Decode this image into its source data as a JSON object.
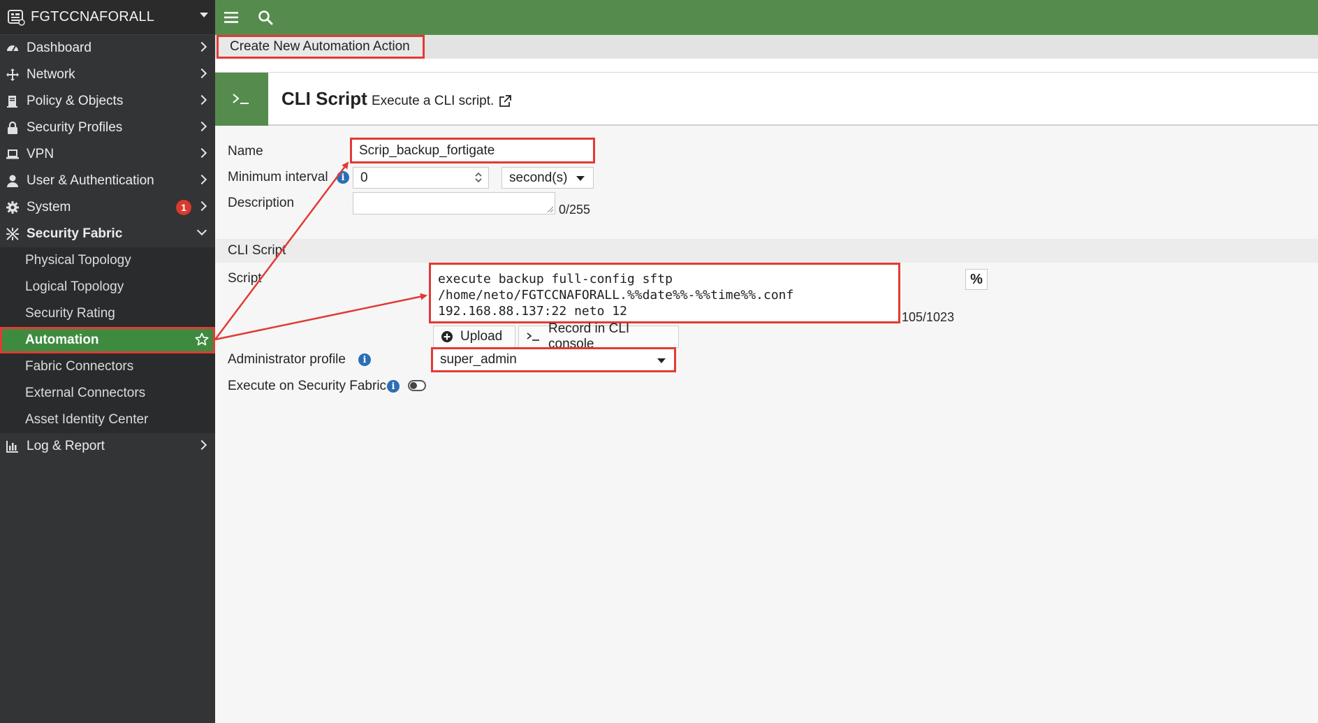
{
  "brand": {
    "name": "FGTCCNAFORALL"
  },
  "sidebar": {
    "items": [
      {
        "label": "Dashboard",
        "icon": "dashboard-icon"
      },
      {
        "label": "Network",
        "icon": "network-icon"
      },
      {
        "label": "Policy & Objects",
        "icon": "policy-icon"
      },
      {
        "label": "Security Profiles",
        "icon": "lock-icon"
      },
      {
        "label": "VPN",
        "icon": "laptop-icon"
      },
      {
        "label": "User & Authentication",
        "icon": "user-icon"
      },
      {
        "label": "System",
        "icon": "gear-icon",
        "badge": "1"
      },
      {
        "label": "Security Fabric",
        "icon": "fabric-icon"
      }
    ],
    "fabric_sub": [
      {
        "label": "Physical Topology"
      },
      {
        "label": "Logical Topology"
      },
      {
        "label": "Security Rating"
      },
      {
        "label": "Automation"
      },
      {
        "label": "Fabric Connectors"
      },
      {
        "label": "External Connectors"
      },
      {
        "label": "Asset Identity Center"
      }
    ],
    "log_report": {
      "label": "Log & Report",
      "icon": "chart-icon"
    }
  },
  "breadcrumb": {
    "title": "Create New Automation Action"
  },
  "action": {
    "title": "CLI Script",
    "description": "Execute a CLI script."
  },
  "form": {
    "name_label": "Name",
    "name_value": "Scrip_backup_fortigate",
    "interval_label": "Minimum interval",
    "interval_value": "0",
    "interval_unit": "second(s)",
    "description_label": "Description",
    "description_value": "",
    "description_count": "0/255",
    "section_title": "CLI Script",
    "script_label": "Script",
    "script_value": "execute backup full-config sftp\n/home/neto/FGTCCNAFORALL.%%date%%-%%time%%.conf\n192.168.88.137:22 neto 12",
    "script_count": "105/1023",
    "percent_symbol": "%",
    "upload_label": "Upload",
    "record_label": "Record in CLI console",
    "admin_profile_label": "Administrator profile",
    "admin_profile_value": "super_admin",
    "exec_fabric_label": "Execute on Security Fabric"
  },
  "colors": {
    "accent_green": "#558c4e",
    "highlight_red": "#e23a35",
    "sidebar_bg": "#333435",
    "info_blue": "#2a6fb5"
  }
}
